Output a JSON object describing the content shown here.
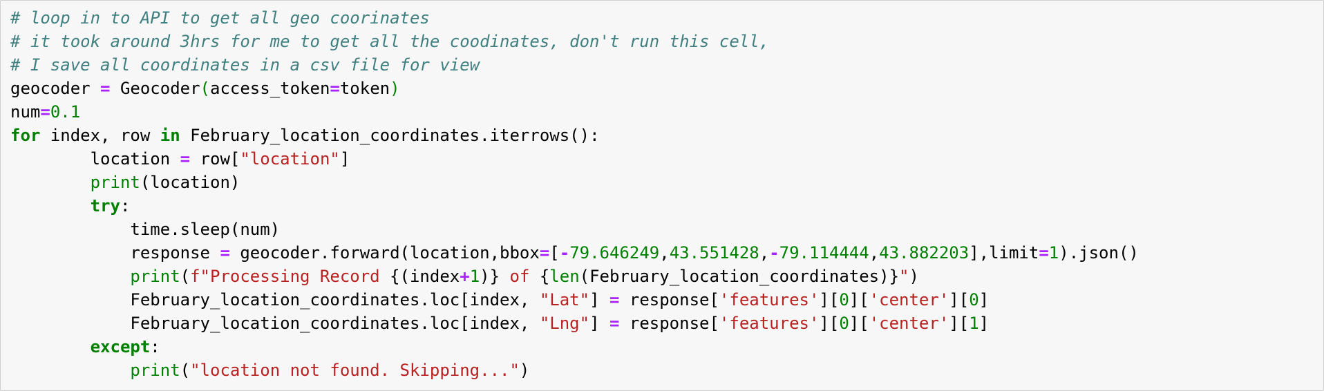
{
  "code_cell": {
    "lines": [
      [
        [
          "comment",
          "# loop in to API to get all geo coorinates"
        ]
      ],
      [
        [
          "comment",
          "# it took around 3hrs for me to get all the coodinates, don't run this cell,"
        ]
      ],
      [
        [
          "comment",
          "# I save all coordinates in a csv file for view"
        ]
      ],
      [
        [
          "name",
          "geocoder "
        ],
        [
          "op",
          "="
        ],
        [
          "name",
          " Geocoder"
        ],
        [
          "builtin",
          "("
        ],
        [
          "name",
          "access_token"
        ],
        [
          "op",
          "="
        ],
        [
          "name",
          "token"
        ],
        [
          "builtin",
          ")"
        ]
      ],
      [
        [
          "name",
          "num"
        ],
        [
          "op",
          "="
        ],
        [
          "num",
          "0.1"
        ]
      ],
      [
        [
          "kw",
          "for"
        ],
        [
          "name",
          " index, row "
        ],
        [
          "kw",
          "in"
        ],
        [
          "name",
          " February_location_coordinates.iterrows():"
        ]
      ],
      [
        [
          "name",
          "        location "
        ],
        [
          "op",
          "="
        ],
        [
          "name",
          " row["
        ],
        [
          "str",
          "\"location\""
        ],
        [
          "name",
          "]"
        ]
      ],
      [
        [
          "name",
          "        "
        ],
        [
          "builtin",
          "print"
        ],
        [
          "name",
          "(location)"
        ]
      ],
      [
        [
          "name",
          "        "
        ],
        [
          "kw",
          "try"
        ],
        [
          "name",
          ":"
        ]
      ],
      [
        [
          "name",
          "            time.sleep(num)"
        ]
      ],
      [
        [
          "name",
          "            response "
        ],
        [
          "op",
          "="
        ],
        [
          "name",
          " geocoder.forward(location,bbox"
        ],
        [
          "op",
          "="
        ],
        [
          "name",
          "["
        ],
        [
          "op",
          "-"
        ],
        [
          "num",
          "79.646249"
        ],
        [
          "name",
          ","
        ],
        [
          "num",
          "43.551428"
        ],
        [
          "name",
          ","
        ],
        [
          "op",
          "-"
        ],
        [
          "num",
          "79.114444"
        ],
        [
          "name",
          ","
        ],
        [
          "num",
          "43.882203"
        ],
        [
          "name",
          "],limit"
        ],
        [
          "op",
          "="
        ],
        [
          "num",
          "1"
        ],
        [
          "name",
          ").json()"
        ]
      ],
      [
        [
          "name",
          "            "
        ],
        [
          "builtin",
          "print"
        ],
        [
          "name",
          "("
        ],
        [
          "str",
          "f\"Processing Record "
        ],
        [
          "name",
          "{(index"
        ],
        [
          "op",
          "+"
        ],
        [
          "num",
          "1"
        ],
        [
          "name",
          ")}"
        ],
        [
          "str",
          " of "
        ],
        [
          "name",
          "{"
        ],
        [
          "builtin",
          "len"
        ],
        [
          "name",
          "(February_location_coordinates)}"
        ],
        [
          "str",
          "\""
        ],
        [
          "name",
          ")"
        ]
      ],
      [
        [
          "name",
          "            February_location_coordinates.loc[index, "
        ],
        [
          "str",
          "\"Lat\""
        ],
        [
          "name",
          "] "
        ],
        [
          "op",
          "="
        ],
        [
          "name",
          " response["
        ],
        [
          "str",
          "'features'"
        ],
        [
          "name",
          "]["
        ],
        [
          "num",
          "0"
        ],
        [
          "name",
          "]["
        ],
        [
          "str",
          "'center'"
        ],
        [
          "name",
          "]["
        ],
        [
          "num",
          "0"
        ],
        [
          "name",
          "]"
        ]
      ],
      [
        [
          "name",
          "            February_location_coordinates.loc[index, "
        ],
        [
          "str",
          "\"Lng\""
        ],
        [
          "name",
          "] "
        ],
        [
          "op",
          "="
        ],
        [
          "name",
          " response["
        ],
        [
          "str",
          "'features'"
        ],
        [
          "name",
          "]["
        ],
        [
          "num",
          "0"
        ],
        [
          "name",
          "]["
        ],
        [
          "str",
          "'center'"
        ],
        [
          "name",
          "]["
        ],
        [
          "num",
          "1"
        ],
        [
          "name",
          "]"
        ]
      ],
      [
        [
          "name",
          "        "
        ],
        [
          "kw",
          "except"
        ],
        [
          "name",
          ":"
        ]
      ],
      [
        [
          "name",
          "            "
        ],
        [
          "builtin",
          "print"
        ],
        [
          "name",
          "("
        ],
        [
          "str",
          "\"location not found. Skipping...\""
        ],
        [
          "name",
          ")"
        ]
      ]
    ]
  },
  "colors": {
    "background": "#f7f7f7",
    "border": "#cfcfcf",
    "comment": "#408080",
    "keyword": "#008000",
    "operator": "#aa22ff",
    "string": "#ba2121",
    "number": "#008000"
  }
}
